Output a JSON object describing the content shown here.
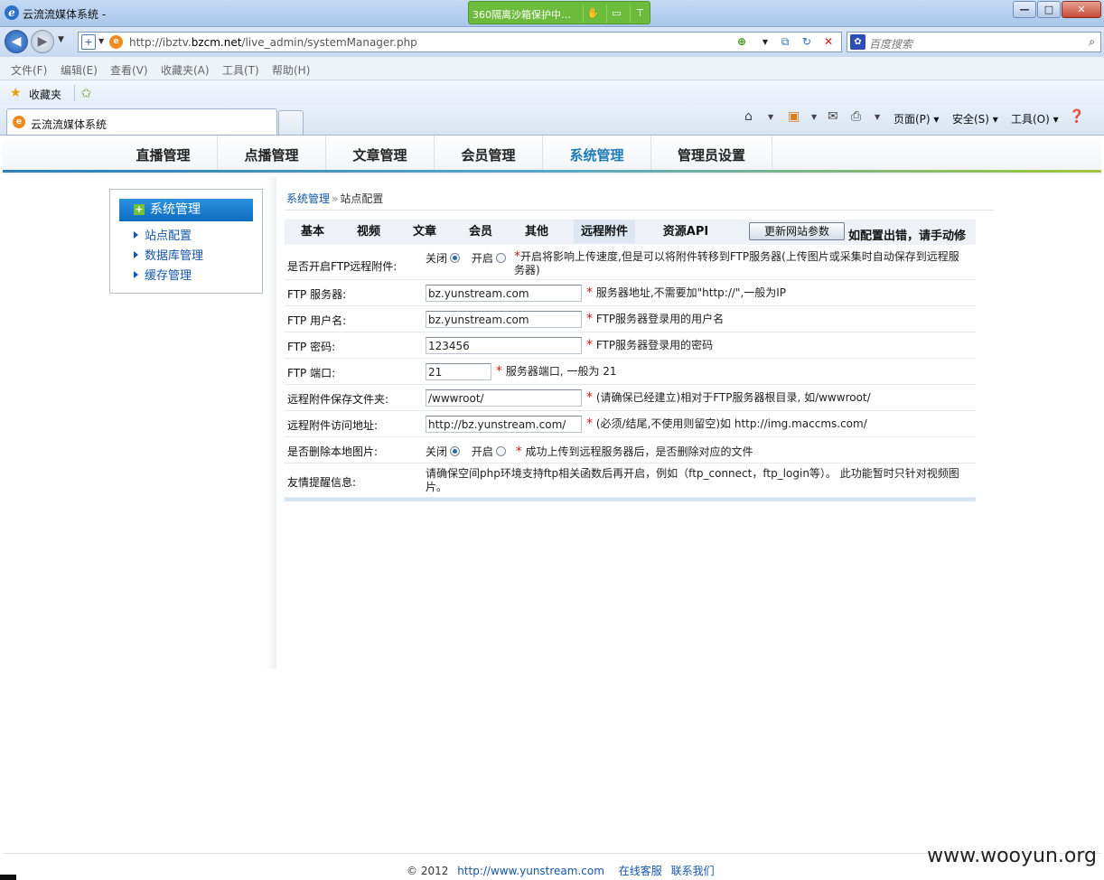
{
  "window": {
    "title": "云流流媒体系统 -",
    "sandbox": "360隔离沙箱保护中…"
  },
  "address": {
    "url_prefix": "http://ibztv.",
    "url_domain": "bzcm.net",
    "url_path": "/live_admin/systemManager.php",
    "search_placeholder": "百度搜索"
  },
  "menu": {
    "items": [
      "文件(F)",
      "编辑(E)",
      "查看(V)",
      "收藏夹(A)",
      "工具(T)",
      "帮助(H)"
    ]
  },
  "favorites": {
    "label": "收藏夹"
  },
  "tab": {
    "title": "云流流媒体系统"
  },
  "commandbar": {
    "page": "页面(P)",
    "safety": "安全(S)",
    "tools": "工具(O)"
  },
  "topnav": {
    "items": [
      "直播管理",
      "点播管理",
      "文章管理",
      "会员管理",
      "系统管理",
      "管理员设置"
    ],
    "active": "系统管理"
  },
  "sidebar": {
    "header": "系统管理",
    "items": [
      "站点配置",
      "数据库管理",
      "缓存管理"
    ]
  },
  "breadcrumb": {
    "root": "系统管理",
    "separator": "»",
    "current": "站点配置"
  },
  "subtabs": {
    "items": [
      "基本",
      "视频",
      "文章",
      "会员",
      "其他",
      "远程附件",
      "资源API"
    ],
    "active": "远程附件"
  },
  "update": {
    "button": "更新网站参数",
    "note": "如配置出错，请手动修"
  },
  "form": {
    "ftp_enable": {
      "label": "是否开启FTP远程附件:",
      "off": "关闭",
      "on": "开启",
      "selected": "关闭",
      "hint": "开启将影响上传速度,但是可以将附件转移到FTP服务器(上传图片或采集时自动保存到远程服务器)"
    },
    "ftp_server": {
      "label": "FTP 服务器:",
      "value": "bz.yunstream.com",
      "hint": "服务器地址,不需要加\"http://\",一般为IP"
    },
    "ftp_user": {
      "label": "FTP 用户名:",
      "value": "bz.yunstream.com",
      "hint": "FTP服务器登录用的用户名"
    },
    "ftp_pass": {
      "label": "FTP 密码:",
      "value": "123456",
      "hint": "FTP服务器登录用的密码"
    },
    "ftp_port": {
      "label": "FTP 端口:",
      "value": "21",
      "hint": "服务器端口, 一般为  21"
    },
    "remote_dir": {
      "label": "远程附件保存文件夹:",
      "value": "/wwwroot/",
      "hint": "(请确保已经建立)相对于FTP服务器根目录, 如/wwwroot/"
    },
    "remote_url": {
      "label": "远程附件访问地址:",
      "value": "http://bz.yunstream.com/",
      "hint": "(必须/结尾,不使用则留空)如  http://img.maccms.com/"
    },
    "delete_local": {
      "label": "是否删除本地图片:",
      "off": "关闭",
      "on": "开启",
      "selected": "关闭",
      "hint": "成功上传到远程服务器后，是否删除对应的文件"
    },
    "notice": {
      "label": "友情提醒信息:",
      "text": "请确保空间php环境支持ftp相关函数后再开启，例如（ftp_connect，ftp_login等）。 此功能暂时只针对视频图片。"
    }
  },
  "footer": {
    "copyright": "© 2012",
    "site": "http://www.yunstream.com",
    "service": "在线客服",
    "contact": "联系我们"
  },
  "watermark": "www.wooyun.org"
}
